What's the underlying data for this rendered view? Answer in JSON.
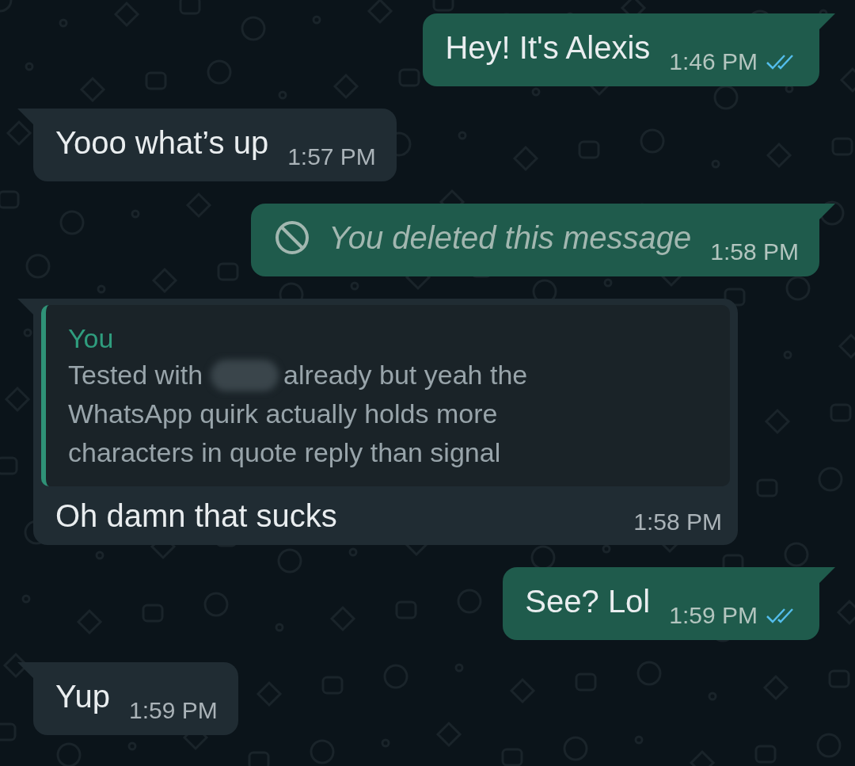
{
  "messages": [
    {
      "outgoing": true,
      "kind": "text",
      "text": "Hey! It's Alexis",
      "time": "1:46 PM",
      "read": true
    },
    {
      "outgoing": false,
      "kind": "text",
      "text": "Yooo what’s up",
      "time": "1:57 PM"
    },
    {
      "outgoing": true,
      "kind": "deleted",
      "text": "You deleted this message",
      "time": "1:58 PM"
    },
    {
      "outgoing": false,
      "kind": "reply",
      "quote": {
        "author": "You",
        "text_before": "Tested with",
        "redacted": true,
        "text_after": "already but yeah the",
        "lines": [
          "WhatsApp quirk actually holds more",
          "characters in quote reply than signal"
        ]
      },
      "text": "Oh damn that sucks",
      "time": "1:58 PM"
    },
    {
      "outgoing": true,
      "kind": "text",
      "text": "See? Lol",
      "time": "1:59 PM",
      "read": true
    },
    {
      "outgoing": false,
      "kind": "text",
      "text": "Yup",
      "time": "1:59 PM"
    }
  ]
}
